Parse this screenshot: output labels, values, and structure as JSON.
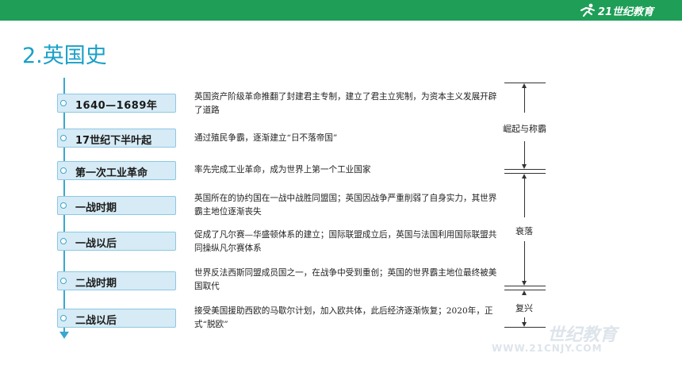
{
  "header": {
    "logo_text": "21世纪教育",
    "bar_color": "#1f9e57"
  },
  "title": "2.英国史",
  "periods": [
    {
      "label": "1640—1689年",
      "desc": "英国资产阶级革命推翻了封建君主专制，建立了君主立宪制，为资本主义发展开辟了道路"
    },
    {
      "label": "17世纪下半叶起",
      "desc": "通过殖民争霸，逐渐建立“日不落帝国”"
    },
    {
      "label": "第一次工业革命",
      "desc": "率先完成工业革命，成为世界上第一个工业国家"
    },
    {
      "label": "一战时期",
      "desc": "英国所在的协约国在一战中战胜同盟国；英国因战争严重削弱了自身实力，其世界霸主地位逐渐丧失"
    },
    {
      "label": "一战以后",
      "desc": "促成了凡尔赛—华盛顿体系的建立；国际联盟成立后，英国与法国利用国际联盟共同操纵凡尔赛体系"
    },
    {
      "label": "二战时期",
      "desc": "世界反法西斯同盟成员国之一，在战争中受到重创；英国的世界霸主地位最终被美国取代"
    },
    {
      "label": "二战以后",
      "desc": "接受美国援助西欧的马歇尔计划，加入欧共体，此后经济逐渐恢复；2020年，正式“脱欧”"
    }
  ],
  "phases": [
    {
      "label": "崛起与称霸"
    },
    {
      "label": "衰落"
    },
    {
      "label": "复兴"
    }
  ],
  "watermark": {
    "big": "世纪教育",
    "small": "WWW.21CNJY.COM"
  },
  "colors": {
    "title": "#1aa0c8",
    "timeline": "#3aa7d1",
    "period_fill": "#d6ebf5"
  }
}
